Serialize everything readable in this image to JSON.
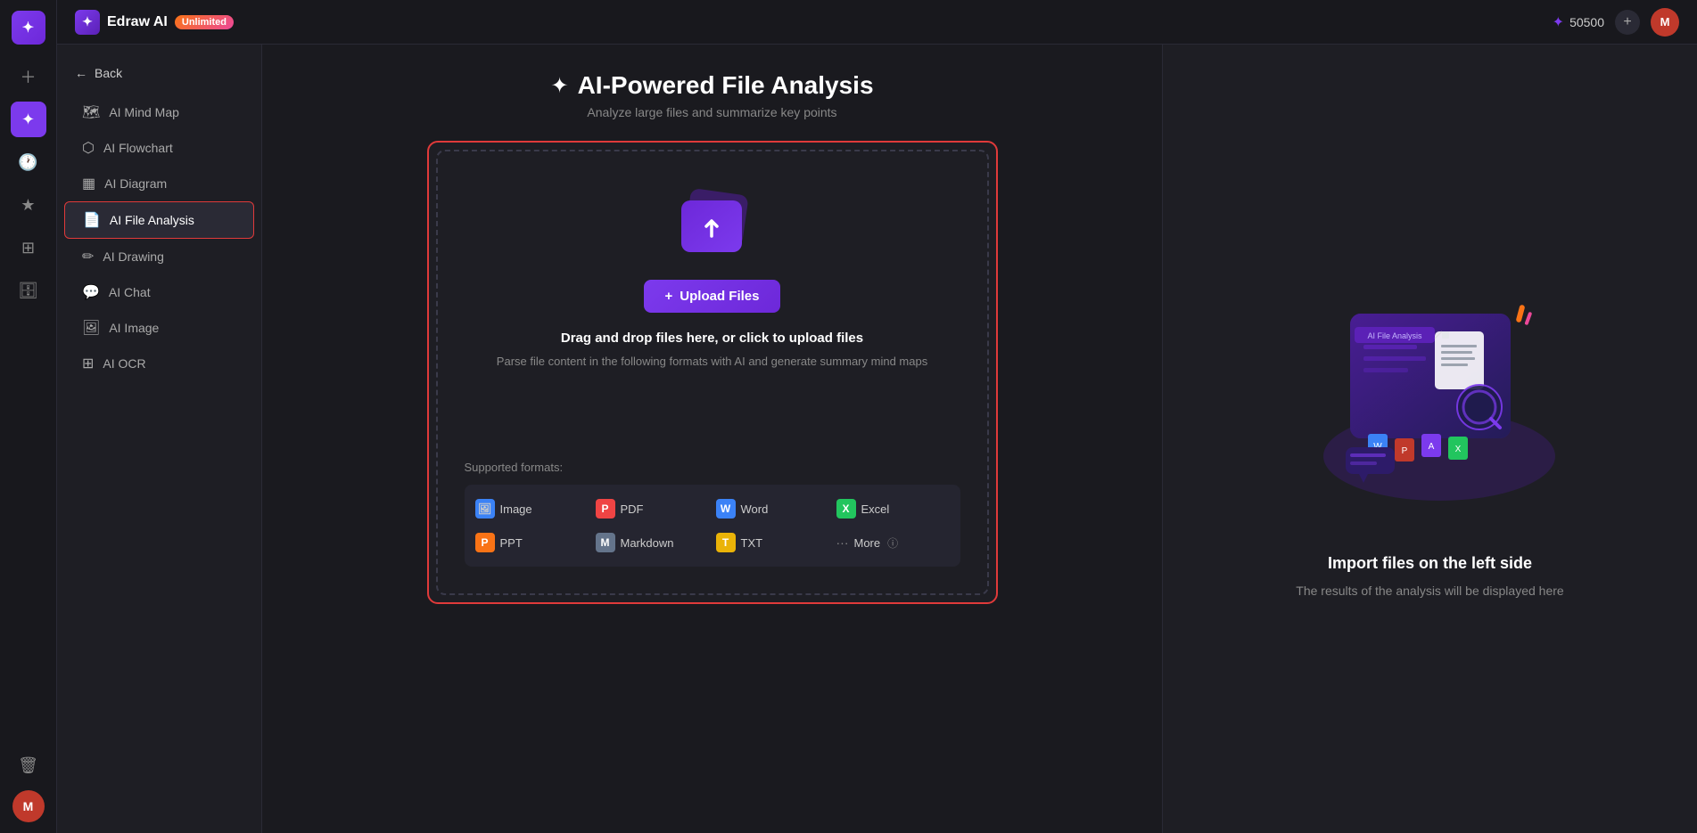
{
  "app": {
    "logo_text": "✦",
    "brand_name": "Edraw AI",
    "badge_text": "Unlimited",
    "credits": "50500",
    "plus_icon": "+",
    "avatar_text": "M"
  },
  "top_bar": {
    "credits_label": "50500",
    "add_icon": "+",
    "avatar_text": "M"
  },
  "sidebar": {
    "back_label": "Back",
    "items": [
      {
        "id": "ai-mind-map",
        "label": "AI Mind Map",
        "icon": "🗺"
      },
      {
        "id": "ai-flowchart",
        "label": "AI Flowchart",
        "icon": "⬡"
      },
      {
        "id": "ai-diagram",
        "label": "AI Diagram",
        "icon": "▦"
      },
      {
        "id": "ai-file-analysis",
        "label": "AI File Analysis",
        "icon": "📄",
        "active": true
      },
      {
        "id": "ai-drawing",
        "label": "AI Drawing",
        "icon": "✏"
      },
      {
        "id": "ai-chat",
        "label": "AI Chat",
        "icon": "💬"
      },
      {
        "id": "ai-image",
        "label": "AI Image",
        "icon": "🖼"
      },
      {
        "id": "ai-ocr",
        "label": "AI OCR",
        "icon": "⊞"
      }
    ]
  },
  "icon_bar": {
    "items": [
      {
        "id": "new",
        "icon": "＋",
        "active": false
      },
      {
        "id": "ai",
        "icon": "✦",
        "active": true
      },
      {
        "id": "recent",
        "icon": "🕐",
        "active": false
      },
      {
        "id": "star",
        "icon": "★",
        "active": false
      },
      {
        "id": "template",
        "icon": "⊞",
        "active": false
      },
      {
        "id": "storage",
        "icon": "🗄",
        "active": false
      },
      {
        "id": "trash",
        "icon": "🗑",
        "active": false
      }
    ],
    "avatar_text": "M"
  },
  "page": {
    "sparkle": "✦",
    "title": "AI-Powered File Analysis",
    "subtitle": "Analyze large files and summarize key points"
  },
  "upload": {
    "button_label": "Upload Files",
    "button_icon": "+",
    "drag_text": "Drag and drop files here, or click to upload files",
    "hint_text": "Parse file content in the following formats with AI and generate summary mind maps",
    "supported_label": "Supported formats:",
    "formats": [
      {
        "id": "image",
        "label": "Image",
        "color": "fmt-image",
        "icon": "🖼"
      },
      {
        "id": "pdf",
        "label": "PDF",
        "color": "fmt-pdf",
        "icon": "P"
      },
      {
        "id": "word",
        "label": "Word",
        "color": "fmt-word",
        "icon": "W"
      },
      {
        "id": "excel",
        "label": "Excel",
        "color": "fmt-excel",
        "icon": "X"
      },
      {
        "id": "ppt",
        "label": "PPT",
        "color": "fmt-ppt",
        "icon": "P"
      },
      {
        "id": "markdown",
        "label": "Markdown",
        "color": "fmt-markdown",
        "icon": "M"
      },
      {
        "id": "txt",
        "label": "TXT",
        "color": "fmt-txt",
        "icon": "T"
      },
      {
        "id": "more",
        "label": "More",
        "color": "fmt-more",
        "icon": "···"
      }
    ]
  },
  "right_panel": {
    "title": "Import files on the left side",
    "description": "The results of the analysis will be displayed here"
  }
}
